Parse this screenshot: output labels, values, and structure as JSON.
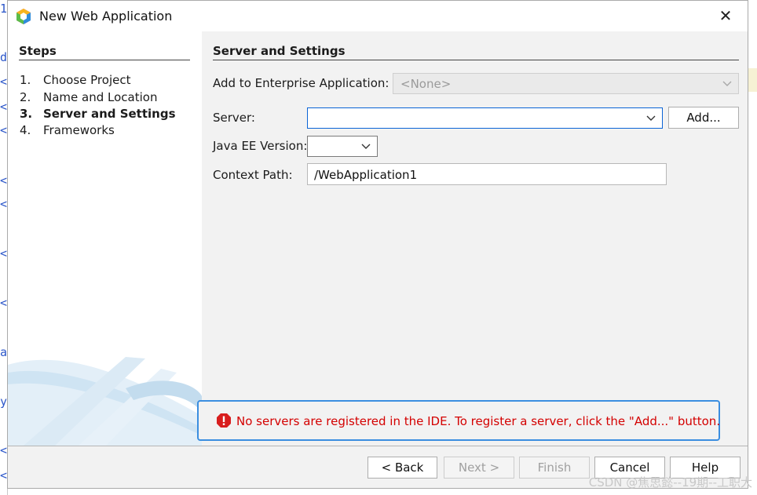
{
  "window": {
    "title": "New Web Application",
    "close_glyph": "✕"
  },
  "steps": {
    "title": "Steps",
    "items": [
      {
        "num": "1.",
        "label": "Choose Project"
      },
      {
        "num": "2.",
        "label": "Name and Location"
      },
      {
        "num": "3.",
        "label": "Server and Settings"
      },
      {
        "num": "4.",
        "label": "Frameworks"
      }
    ]
  },
  "section": {
    "title": "Server and Settings"
  },
  "form": {
    "enterprise_label": "Add to Enterprise Application:",
    "enterprise_value": "<None>",
    "server_label": "Server:",
    "server_value": "",
    "add_label": "Add...",
    "javaee_label": "Java EE Version:",
    "javaee_value": "",
    "context_label": "Context Path:",
    "context_value": "/WebApplication1"
  },
  "error": {
    "message": "No servers are registered in the IDE. To register a server, click the \"Add...\" button."
  },
  "buttons": {
    "back": "< Back",
    "next": "Next >",
    "finish": "Finish",
    "cancel": "Cancel",
    "help": "Help"
  },
  "watermark": "CSDN @焦思懿--19期--工职大",
  "background_glyphs": [
    "1",
    "d",
    "<",
    "<",
    "<",
    "<",
    "<",
    "<",
    "<",
    "a",
    "y",
    "<",
    "<"
  ],
  "icons": {
    "app": "netbeans-cube-icon",
    "close": "close-icon",
    "chevron": "chevron-down-icon",
    "error": "error-icon"
  },
  "colors": {
    "error_text": "#d40000",
    "focus_border": "#3b8ee0",
    "background_link": "#2b56c9"
  }
}
